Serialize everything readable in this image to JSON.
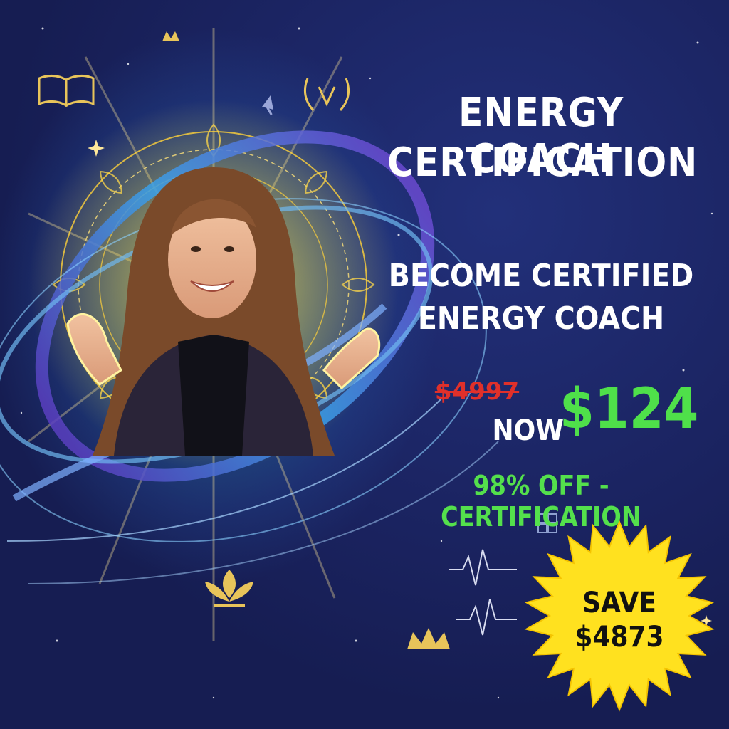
{
  "headline": {
    "title_line1": "ENERGY COACH",
    "title_line2": "CERTIFICATION",
    "subtitle_line1": "BECOME CERTIFIED",
    "subtitle_line2": "ENERGY COACH"
  },
  "pricing": {
    "old_price": "$4997",
    "now_label": "NOW",
    "new_price": "$124",
    "discount": "98% OFF - CERTIFICATION"
  },
  "badge": {
    "line1": "SAVE",
    "line2": "$4873"
  },
  "icons": [
    "open-book-icon",
    "crown-icon",
    "laurel-v-icon",
    "arrow-icon",
    "pulse-wave-icon",
    "lotus-icon",
    "grid-icon",
    "sparkle-icon"
  ],
  "colors": {
    "background": "#1b2462",
    "headline": "#ffffff",
    "old_price": "#e0302a",
    "new_price": "#4fe04a",
    "glow": "#ffd23a",
    "burst": "#ffe11f"
  }
}
